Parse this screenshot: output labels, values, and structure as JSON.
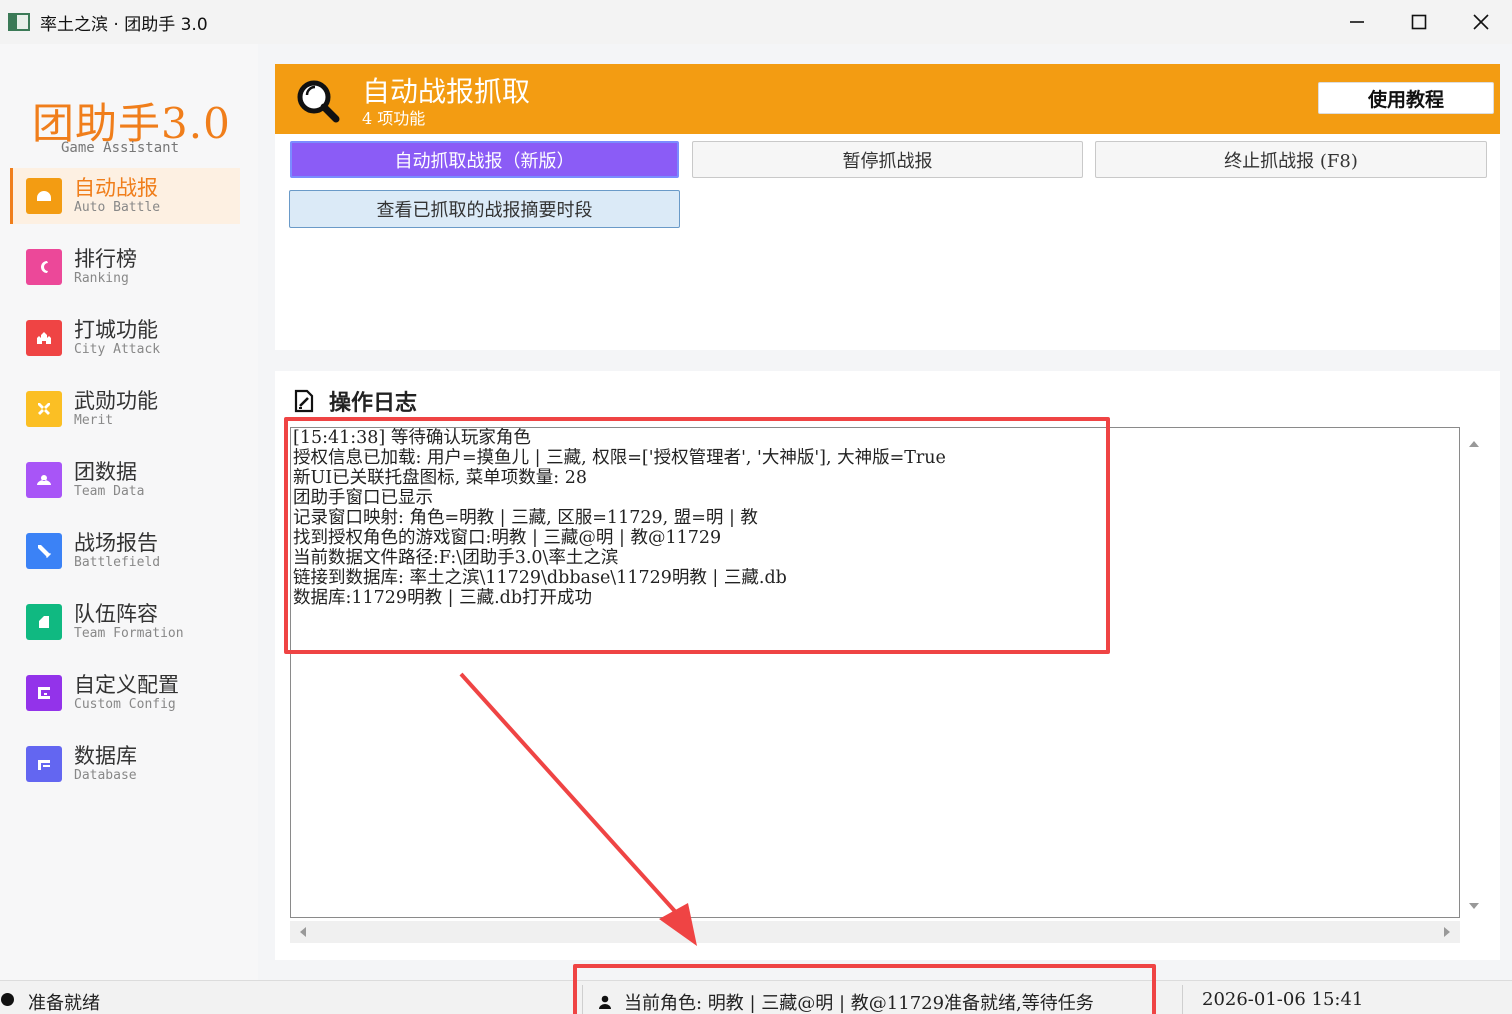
{
  "window": {
    "title": "率土之滨 · 团助手 3.0"
  },
  "sidebar": {
    "logo": "团助手3.0",
    "logo_sub": "Game Assistant",
    "items": [
      {
        "label": "自动战报",
        "sub": "Auto Battle",
        "color": "#f39c12",
        "icon": "helmet-icon"
      },
      {
        "label": "排行榜",
        "sub": "Ranking",
        "color": "#ec4899",
        "icon": "horseshoe-icon"
      },
      {
        "label": "打城功能",
        "sub": "City Attack",
        "color": "#ef4444",
        "icon": "castle-icon"
      },
      {
        "label": "武勋功能",
        "sub": "Merit",
        "color": "#fbbf24",
        "icon": "crossed-swords-icon"
      },
      {
        "label": "团数据",
        "sub": "Team Data",
        "color": "#a855f7",
        "icon": "team-icon"
      },
      {
        "label": "战场报告",
        "sub": "Battlefield",
        "color": "#3b82f6",
        "icon": "sword-icon"
      },
      {
        "label": "队伍阵容",
        "sub": "Team Formation",
        "color": "#10b981",
        "icon": "formation-icon"
      },
      {
        "label": "自定义配置",
        "sub": "Custom Config",
        "color": "#9333ea",
        "icon": "config-icon"
      },
      {
        "label": "数据库",
        "sub": "Database",
        "color": "#6366f1",
        "icon": "database-icon"
      }
    ]
  },
  "feature": {
    "title": "自动战报抓取",
    "count": "4 项功能",
    "tutorial": "使用教程",
    "accent": "#f39c12",
    "buttons": {
      "auto": "自动抓取战报（新版）",
      "pause": "暂停抓战报",
      "stop": "终止抓战报 (F8)",
      "view": "查看已抓取的战报摘要时段"
    }
  },
  "log": {
    "title": "操作日志",
    "lines": [
      "[15:41:38] 等待确认玩家角色",
      "授权信息已加载: 用户=摸鱼儿 | 三藏, 权限=['授权管理者', '大神版'], 大神版=True",
      "新UI已关联托盘图标, 菜单项数量: 28",
      "团助手窗口已显示",
      "记录窗口映射: 角色=明教 | 三藏, 区服=11729, 盟=明 | 教",
      "找到授权角色的游戏窗口:明教 | 三藏@明 | 教@11729",
      "当前数据文件路径:F:\\团助手3.0\\率土之滨",
      "链接到数据库: 率土之滨\\11729\\dbbase\\11729明教 | 三藏.db",
      "数据库:11729明教 | 三藏.db打开成功"
    ]
  },
  "status": {
    "ready": "准备就绪",
    "role": "当前角色: 明教 | 三藏@明 | 教@11729准备就绪,等待任务",
    "time": "2026-01-06 15:41"
  }
}
